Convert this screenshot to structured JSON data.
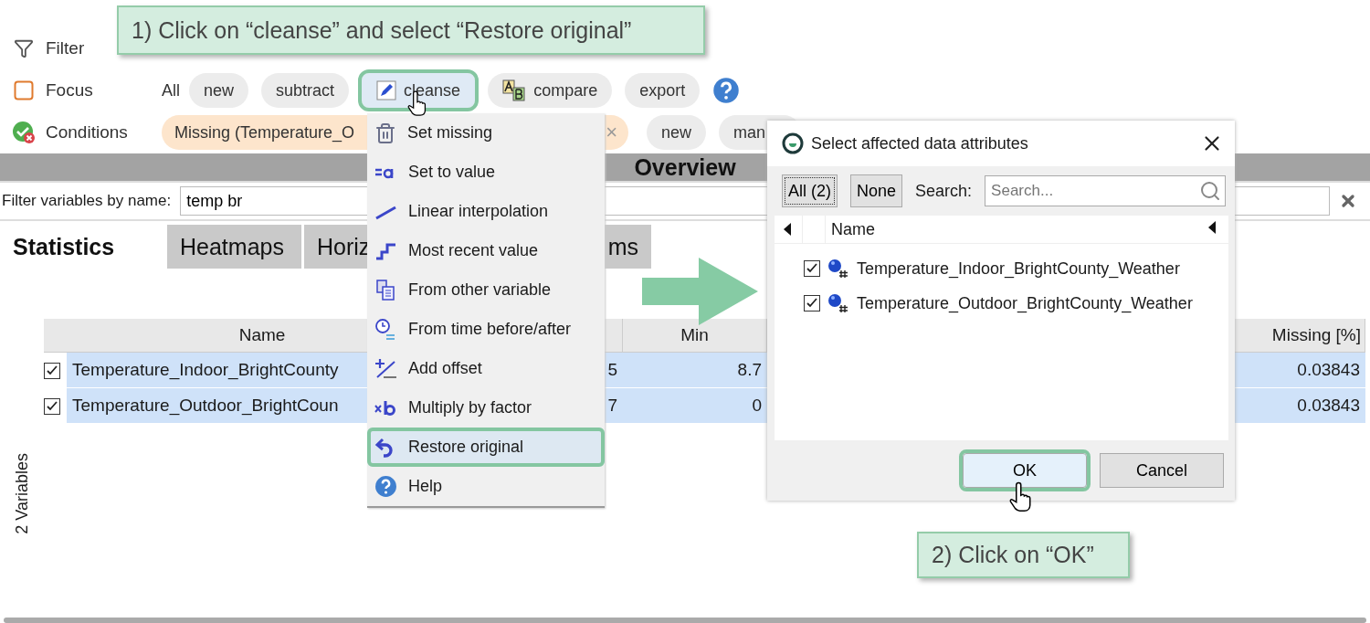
{
  "filter_row": {
    "label": "Filter"
  },
  "focus_row": {
    "label": "Focus",
    "all_label": "All",
    "chips": [
      {
        "label": "new",
        "kind": "plain",
        "highlighted": false
      },
      {
        "label": "subtract",
        "kind": "plain",
        "highlighted": false
      },
      {
        "label": "cleanse",
        "kind": "pencil",
        "highlighted": true
      },
      {
        "label": "compare",
        "kind": "ab",
        "highlighted": false
      },
      {
        "label": "export",
        "kind": "plain",
        "highlighted": false
      }
    ]
  },
  "conditions_row": {
    "label": "Conditions",
    "condition": {
      "text": "Missing (Temperature_O",
      "close": "×"
    },
    "chips": [
      "new",
      "man"
    ]
  },
  "overview": {
    "title": "Overview"
  },
  "name_filter": {
    "label": "Filter variables by name:",
    "value": "temp br"
  },
  "tabs": [
    {
      "label": "Statistics",
      "selected": true
    },
    {
      "label": "Heatmaps",
      "selected": false
    },
    {
      "label": "Horiz",
      "selected": false
    },
    {
      "label": "ms",
      "selected": false
    }
  ],
  "side_label": "2 Variables",
  "table": {
    "columns": [
      "Name",
      "Min",
      "Missing [%]"
    ],
    "rows": [
      {
        "checked": true,
        "selected": true,
        "name": "Temperature_Indoor_BrightCounty",
        "column_2": "5",
        "min": "8.7",
        "missing": "0.03843"
      },
      {
        "checked": true,
        "selected": true,
        "name": "Temperature_Outdoor_BrightCoun",
        "column_2": "7",
        "min": "0",
        "missing": "0.03843"
      }
    ]
  },
  "menu": [
    {
      "label": "Set missing",
      "kind": "trash",
      "highlighted": false
    },
    {
      "label": "Set to value",
      "kind": "equals",
      "highlighted": false
    },
    {
      "label": "Linear interpolation",
      "kind": "line",
      "highlighted": false
    },
    {
      "label": "Most recent value",
      "kind": "step",
      "highlighted": false
    },
    {
      "label": "From other variable",
      "kind": "copy",
      "highlighted": false
    },
    {
      "label": "From time before/after",
      "kind": "clock",
      "highlighted": false
    },
    {
      "label": "Add offset",
      "kind": "offset",
      "highlighted": false
    },
    {
      "label": "Multiply by factor",
      "kind": "times",
      "highlighted": false
    },
    {
      "label": "Restore original",
      "kind": "undo",
      "highlighted": true
    },
    {
      "label": "Help",
      "kind": "help",
      "highlighted": false
    }
  ],
  "dialog": {
    "title": "Select affected data attributes",
    "select_buttons": [
      {
        "label": "All (2)",
        "focused": true
      },
      {
        "label": "None",
        "focused": false
      }
    ],
    "search_label": "Search:",
    "search_placeholder": "Search...",
    "list_header": "Name",
    "items": [
      {
        "name": "Temperature_Indoor_BrightCounty_Weather",
        "checked": true
      },
      {
        "name": "Temperature_Outdoor_BrightCounty_Weather",
        "checked": true
      }
    ],
    "buttons": [
      {
        "label": "OK",
        "highlighted": true
      },
      {
        "label": "Cancel",
        "highlighted": false
      }
    ]
  },
  "callouts": [
    {
      "text": "1) Click on “cleanse” and select “Restore original”"
    },
    {
      "text": "2) Click on “OK”"
    }
  ]
}
